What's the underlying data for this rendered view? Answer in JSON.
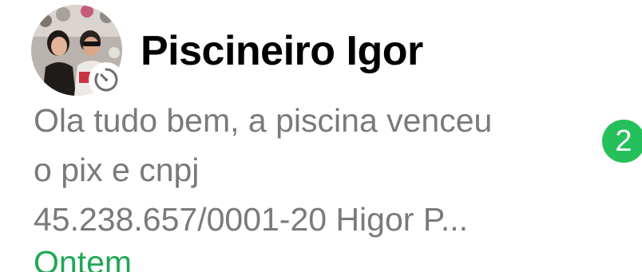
{
  "chat": {
    "contact_name": "Piscineiro Igor",
    "preview_lines": [
      "Ola tudo bem, a piscina venceu",
      "o pix e cnpj",
      "45.238.657/0001-20 Higor P..."
    ],
    "unread_count": "2",
    "timestamp": "Ontem",
    "avatar_icon": "contact-photo",
    "status_icon": "timer-icon"
  },
  "colors": {
    "name": "#000000",
    "preview": "#7a7a7a",
    "badge": "#25c05b",
    "timestamp": "#1fa855"
  }
}
